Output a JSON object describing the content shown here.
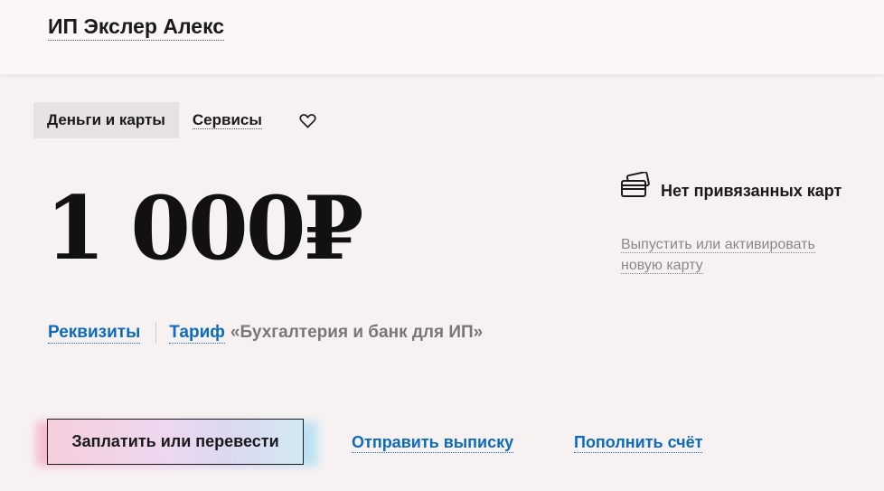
{
  "header": {
    "company_name": "ИП Экслер Алекс"
  },
  "tabs": [
    {
      "label": "Деньги и карты",
      "active": true
    },
    {
      "label": "Сервисы",
      "active": false
    }
  ],
  "favorites_icon": "heart-outline-icon",
  "balance": {
    "amount": "1 000₽"
  },
  "details": {
    "requisites_label": "Реквизиты",
    "tariff_label": "Тариф",
    "tariff_name": "«Бухгалтерия и банк для ИП»"
  },
  "cards": {
    "icon": "cards-icon",
    "status": "Нет привязанных карт",
    "issue_link": "Выпустить или активировать новую карту"
  },
  "actions": {
    "pay_button": "Заплатить или перевести",
    "send_statement": "Отправить выписку",
    "top_up": "Пополнить счёт"
  },
  "colors": {
    "background": "#f7f2f1",
    "link_blue": "#0c6bbf",
    "muted_text": "#888888"
  }
}
